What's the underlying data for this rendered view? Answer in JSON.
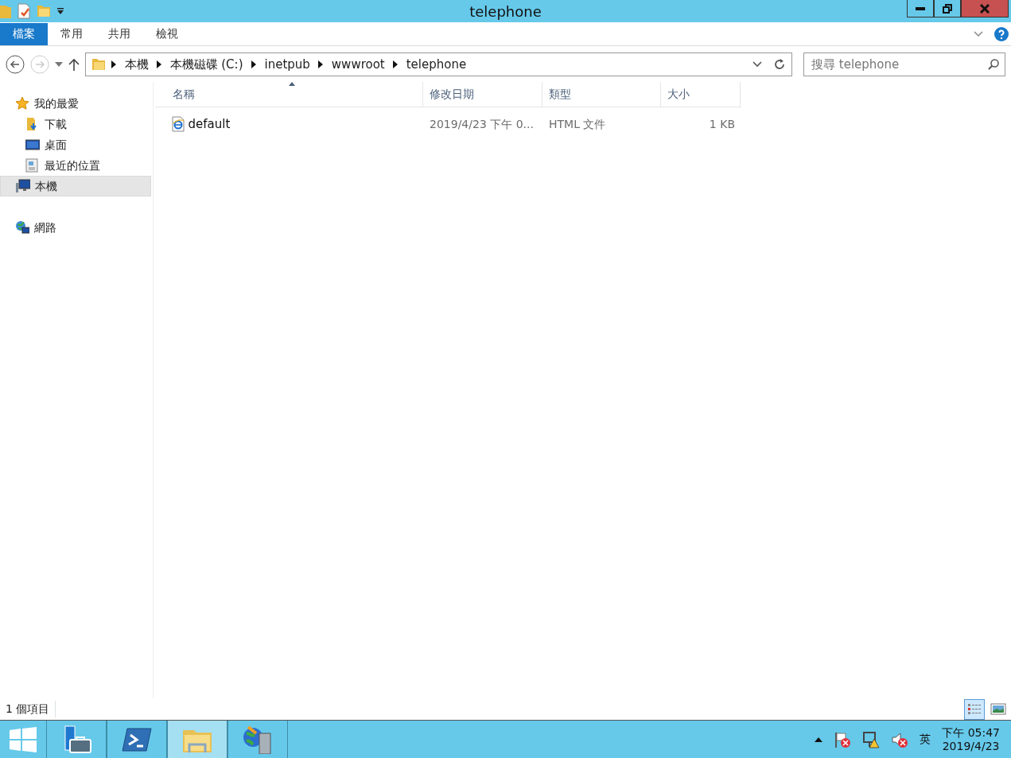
{
  "window": {
    "title": "telephone"
  },
  "ribbon": {
    "tabs": [
      {
        "label": "檔案",
        "selected": true
      },
      {
        "label": "常用",
        "selected": false
      },
      {
        "label": "共用",
        "selected": false
      },
      {
        "label": "檢視",
        "selected": false
      }
    ]
  },
  "address": {
    "crumbs": [
      "本機",
      "本機磁碟 (C:)",
      "inetpub",
      "wwwroot",
      "telephone"
    ]
  },
  "search": {
    "placeholder": "搜尋 telephone"
  },
  "sidebar": {
    "items": [
      {
        "label": "我的最愛",
        "kind": "favorites",
        "selected": false,
        "children": [
          {
            "label": "下載",
            "kind": "downloads",
            "selected": false
          },
          {
            "label": "桌面",
            "kind": "desktop",
            "selected": false
          },
          {
            "label": "最近的位置",
            "kind": "recent",
            "selected": false
          }
        ]
      },
      {
        "label": "本機",
        "kind": "computer",
        "selected": true
      },
      {
        "label": "網路",
        "kind": "network",
        "selected": false
      }
    ]
  },
  "table": {
    "columns": [
      {
        "label": "名稱",
        "sorted": true
      },
      {
        "label": "修改日期",
        "sorted": false
      },
      {
        "label": "類型",
        "sorted": false
      },
      {
        "label": "大小",
        "sorted": false
      }
    ],
    "rows": [
      {
        "name": "default",
        "modified": "2019/4/23 下午 0...",
        "type": "HTML 文件",
        "size": "1 KB",
        "selected": false
      }
    ]
  },
  "status_bar": {
    "count": "1 個項目",
    "views": [
      {
        "kind": "details",
        "selected": true
      },
      {
        "kind": "thumbnails",
        "selected": false
      }
    ]
  },
  "taskbar": {
    "apps": [
      {
        "kind": "servermanager",
        "selected": false
      },
      {
        "kind": "powershell",
        "selected": false
      },
      {
        "kind": "explorer",
        "selected": true
      },
      {
        "kind": "iis",
        "selected": false
      }
    ],
    "language": "英",
    "time": "下午 05:47",
    "date": "2019/4/23"
  }
}
